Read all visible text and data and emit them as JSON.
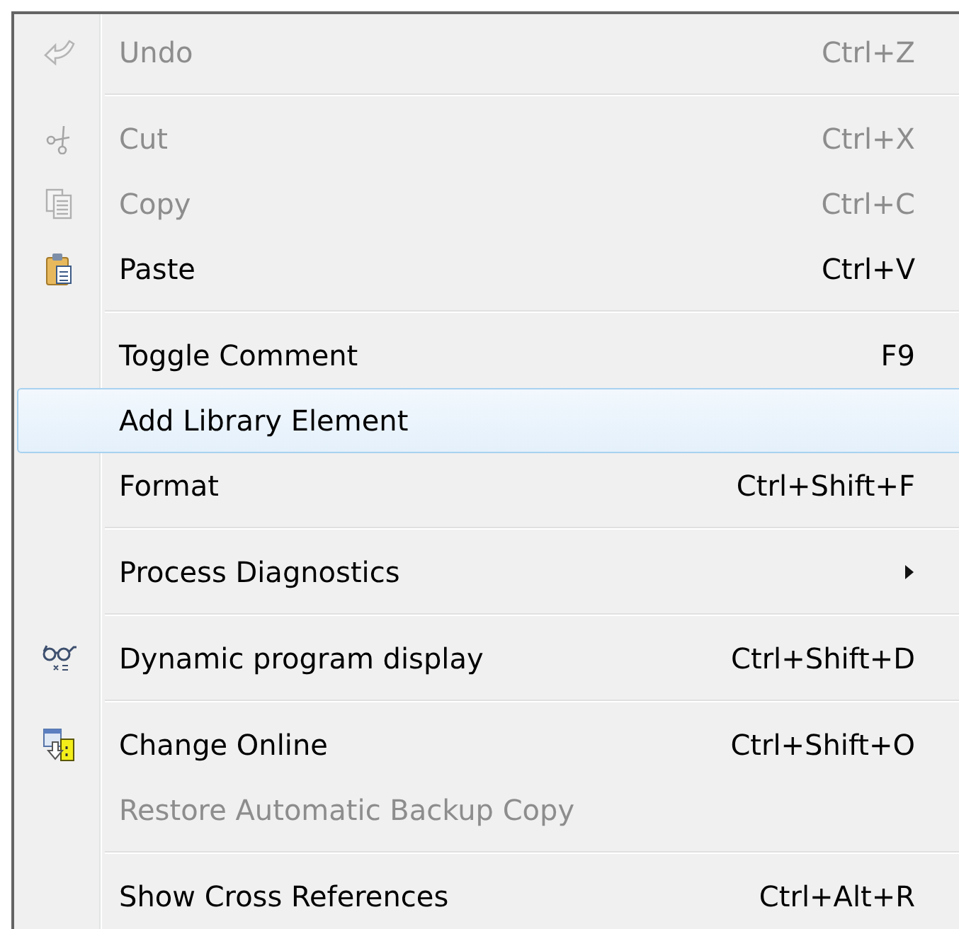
{
  "menu": {
    "items": [
      {
        "kind": "item",
        "label": "Undo",
        "shortcut": "Ctrl+Z",
        "disabled": true,
        "selected": false
      },
      {
        "kind": "separator"
      },
      {
        "kind": "item",
        "label": "Cut",
        "shortcut": "Ctrl+X",
        "disabled": true,
        "selected": false
      },
      {
        "kind": "item",
        "label": "Copy",
        "shortcut": "Ctrl+C",
        "disabled": true,
        "selected": false
      },
      {
        "kind": "item",
        "label": "Paste",
        "shortcut": "Ctrl+V",
        "disabled": false,
        "selected": false
      },
      {
        "kind": "separator"
      },
      {
        "kind": "item",
        "label": "Toggle Comment",
        "shortcut": "F9",
        "disabled": false,
        "selected": false
      },
      {
        "kind": "item",
        "label": "Add Library Element",
        "disabled": false,
        "selected": true
      },
      {
        "kind": "item",
        "label": "Format",
        "shortcut": "Ctrl+Shift+F",
        "disabled": false,
        "selected": false
      },
      {
        "kind": "separator"
      },
      {
        "kind": "item",
        "label": "Process Diagnostics",
        "submenu": true,
        "disabled": false,
        "selected": false
      },
      {
        "kind": "separator"
      },
      {
        "kind": "item",
        "label": "Dynamic program display",
        "shortcut": "Ctrl+Shift+D",
        "disabled": false,
        "selected": false
      },
      {
        "kind": "separator"
      },
      {
        "kind": "item",
        "label": "Change Online",
        "shortcut": "Ctrl+Shift+O",
        "disabled": false,
        "selected": false
      },
      {
        "kind": "item",
        "label": "Restore Automatic Backup Copy",
        "disabled": true,
        "selected": false
      },
      {
        "kind": "separator"
      },
      {
        "kind": "item",
        "label": "Show Cross References",
        "shortcut": "Ctrl+Alt+R",
        "disabled": false,
        "selected": false
      }
    ]
  }
}
